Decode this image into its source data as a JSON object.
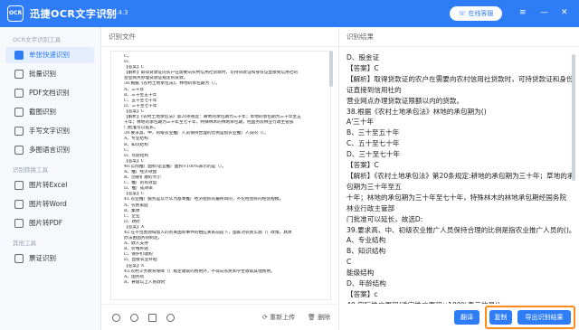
{
  "app": {
    "logo": "OCR",
    "title": "迅捷OCR文字识别",
    "version": "v8.6.4.3",
    "service": "在线客服"
  },
  "window": {
    "controls": [
      "≡",
      "—",
      "✕"
    ]
  },
  "sidebar": {
    "sections": [
      {
        "title": "OCR文字识别工具",
        "items": [
          {
            "label": "单张快速识别",
            "active": true,
            "icon": "image-scan-icon"
          },
          {
            "label": "批量识别",
            "icon": "batch-icon"
          },
          {
            "label": "PDF文档识别",
            "icon": "pdf-icon"
          },
          {
            "label": "截图识别",
            "icon": "screenshot-icon"
          },
          {
            "label": "手写文字识别",
            "icon": "handwriting-icon"
          },
          {
            "label": "多图语言识别",
            "icon": "language-icon"
          }
        ]
      },
      {
        "title": "识别转换工具",
        "items": [
          {
            "label": "图片转Excel",
            "icon": "excel-icon"
          },
          {
            "label": "图片转Word",
            "icon": "word-icon"
          },
          {
            "label": "图片转PDF",
            "icon": "pdf-convert-icon"
          }
        ]
      },
      {
        "title": "其他工具",
        "items": [
          {
            "label": "票证识别",
            "icon": "ticket-icon"
          }
        ]
      }
    ]
  },
  "left_panel": {
    "title": "识别文件",
    "reupload": "重新上传",
    "delete": "删除"
  },
  "right_panel": {
    "title": "识别结果",
    "translate": "翻译",
    "copy": "复制",
    "export": "导出识别结果"
  },
  "document_lines": [
    "C、",
    "D、",
    "【答案】C",
    "【解析】取得贷款证的农户在需要向农村信用社贷款时，可持贷款证和身份证直接到信用社的",
    "营业网点办理贷款证规定的贷款。",
    "38.根据《农村土地承包法》，林地的承包期为（）。",
    "A、三十年",
    "B、三十至五十年",
    "C、五十至七十年",
    "D、三十至七十年",
    "【答案】C",
    "【解析】《农村土地承包法》第20条规定：耕地的承包期为三十年；草地的承包期为三十年至五",
    "十年；林地的承包期为三十年至七十年，特殊林木的林地承包期，经国务院林业行政主管部",
    "门批准可以延长。",
    "39.要求高、中、初级农业推广人员保持合理的比例是指农业推广人员的（）。",
    "A、专业结构",
    "B、知识结构",
    "C、",
    "D、年龄结构",
    "【答案】C",
    "40.实际推广面积/适宜推广面积×100%表示的是（）。",
    "A、推广经济效益",
    "B、创新扩散的大小",
    "C、推广的有效度",
    "D、推广成效率",
    "【答案】C",
    "41.农业推广服务是以什么为基本推广经济组织的最终目的，不论经营好的经营规模。",
    "A、农民家庭",
    "B、集体",
    "C、企业",
    "D、政府",
    "【答案】A",
    "42.在不包围领域加入的有关国际事件的相应关系前提下，国家对农民实施（）政策，具体",
    "办法由国务院制定。",
    "A、收入支持",
    "B、价格补贴",
    "C、保护价收购",
    "D、直接农业补贴",
    "【答案】A",
    "43.农村义务教育保障（）规定收取的费用外，不得向农民和学生收取其他费用。",
    "A、国务院",
    "B、县级以上人民政府"
  ],
  "result_lines": [
    "D、股金证",
    "【答案】C",
    "【解析】取得贷款证的农户在需要向农村信用社贷款时，可持贷款证和身份",
    "证直接到信用社的",
    "营业网点办理贷款证限额以内的贷款。",
    "38.根据《农村土地承包法》林地的承包期为()",
    "A'三十年",
    "B、三十至五十年",
    "C、五十至七十年",
    "D、三十至七十年",
    "【答案】C",
    "【解析】《农村土地承包法》第20条规定:耕地的承包期为三十年；草地的承",
    "包期为三十年至五",
    "十年；林地的承包期为三十年至七十年，特殊林木的林地承包期经国务院",
    "林业行政主管部",
    "门批准可以延长，故选D:",
    "39.要求高、中、初级农业推广人员保持合理的比例是指农业推广人员的()。",
    "A、专业结构",
    "B、知识结构",
    "C",
    "能级结构",
    "D、年龄结构",
    "【答案】c",
    "40.实际推广面积/适宜推广面积×100%表示的是()",
    "A、推广经济效益",
    "B、创新扩散的大小"
  ]
}
